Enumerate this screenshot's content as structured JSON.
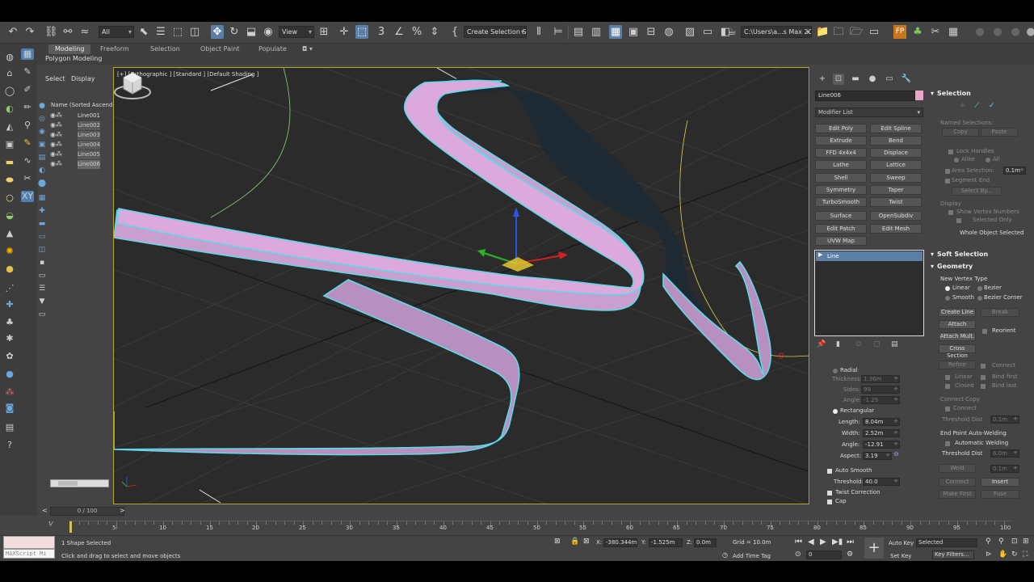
{
  "toolbar": {
    "selection_filter": "All",
    "refcoord": "View",
    "named_selection": "Create Selection Se",
    "project_path": "C:\\Users\\a...s Max 2021"
  },
  "ribbon": {
    "tabs": [
      "Modeling",
      "Freeform",
      "Selection",
      "Object Paint",
      "Populate"
    ],
    "sub_label": "Polygon Modeling"
  },
  "scene_explorer": {
    "tabs": [
      "Select",
      "Display"
    ],
    "column_header": "Name (Sorted Ascendin",
    "items": [
      "Line001",
      "Line002",
      "Line003",
      "Line004",
      "Line005",
      "Line006"
    ]
  },
  "viewport": {
    "label": "[+] [Orthographic ] [Standard ] [Default Shading ]",
    "ribbon_color": "#d9a1d6",
    "outline_color": "#5fd8e8",
    "background": "#2b2b2b"
  },
  "command_panel": {
    "object_name": "Line006",
    "object_color": "#e8a6c8",
    "modifier_list": "Modifier List",
    "modifiers": [
      "Edit Poly",
      "Edit Spline",
      "Extrude",
      "Bend",
      "FFD 4x4x4",
      "Displace",
      "Lathe",
      "Lattice",
      "Shell",
      "Sweep",
      "Symmetry",
      "Taper",
      "TurboSmooth",
      "Twist",
      "Surface",
      "OpenSubdiv",
      "Edit Patch",
      "Edit Mesh",
      "UVW Map"
    ],
    "stack_item": "Line"
  },
  "rendering": {
    "radial": "Radial",
    "thickness_label": "Thickness:",
    "thickness": "1.36m",
    "sides_label": "Sides:",
    "sides": "99",
    "angle1_label": "Angle:",
    "angle1": "-1.29",
    "rectangular": "Rectangular",
    "length_label": "Length:",
    "length": "8.04m",
    "width_label": "Width:",
    "width": "2.52m",
    "angle2_label": "Angle:",
    "angle2": "-12.91",
    "aspect_label": "Aspect:",
    "aspect": "3.19",
    "auto_smooth": "Auto Smooth",
    "threshold_label": "Threshold:",
    "threshold": "40.0",
    "twist_correction": "Twist Correction",
    "cap": "Cap"
  },
  "selection_rollout": {
    "title": "Selection",
    "named_selections": "Named Selections:",
    "copy": "Copy",
    "paste": "Paste",
    "lock_handles": "Lock Handles",
    "alike": "Alike",
    "all": "All",
    "area_selection": "Area Selection:",
    "area_value": "0.1m",
    "segment_end": "Segment End",
    "select_by": "Select By...",
    "display": "Display",
    "show_vertex_numbers": "Show Vertex Numbers",
    "selected_only": "Selected Only",
    "whole_object_selected": "Whole Object Selected"
  },
  "soft_selection": {
    "title": "Soft Selection"
  },
  "geometry": {
    "title": "Geometry",
    "new_vertex_type": "New Vertex Type",
    "linear": "Linear",
    "bezier": "Bezier",
    "smooth": "Smooth",
    "bezier_corner": "Bezier Corner",
    "create_line": "Create Line",
    "break": "Break",
    "attach": "Attach",
    "reorient": "Reorient",
    "attach_mult": "Attach Mult.",
    "cross_section": "Cross Section",
    "refine": "Refine",
    "connect": "Connect",
    "linear2": "Linear",
    "bind_first": "Bind first",
    "closed": "Closed",
    "bind_last": "Bind last",
    "connect_copy": "Connect Copy",
    "connect2": "Connect",
    "threshold_dist": "Threshold Dist",
    "threshold_dist_val": "0.1m",
    "end_point_welding": "End Point Auto-Welding",
    "automatic_welding": "Automatic Welding",
    "threshold_dist2": "Threshold Dist",
    "threshold_dist2_val": "6.0m",
    "weld": "Weld",
    "weld_val": "0.1m",
    "connect3": "Connect",
    "insert": "Insert",
    "make_first": "Make First",
    "fuse": "Fuse"
  },
  "timeline": {
    "frame": "0 / 100",
    "ticks": [
      "5",
      "10",
      "15",
      "20",
      "25",
      "30",
      "35",
      "40",
      "45",
      "50",
      "55",
      "60",
      "65",
      "70",
      "75",
      "80",
      "85",
      "90",
      "95",
      "100"
    ]
  },
  "status": {
    "maxscript": "MAXScript Mi",
    "selected": "1 Shape Selected",
    "prompt": "Click and drag to select and move objects",
    "x_label": "X:",
    "x_value": "-380.344m",
    "y_label": "Y:",
    "y_value": "-1.525m",
    "z_label": "Z:",
    "z_value": "0.0m",
    "grid": "Grid = 10.0m",
    "add_time_tag": "Add Time Tag",
    "auto_key": "Auto Key",
    "set_key": "Set Key",
    "selected_dd": "Selected",
    "key_filters": "Key Filters...",
    "frame_field": "0"
  }
}
